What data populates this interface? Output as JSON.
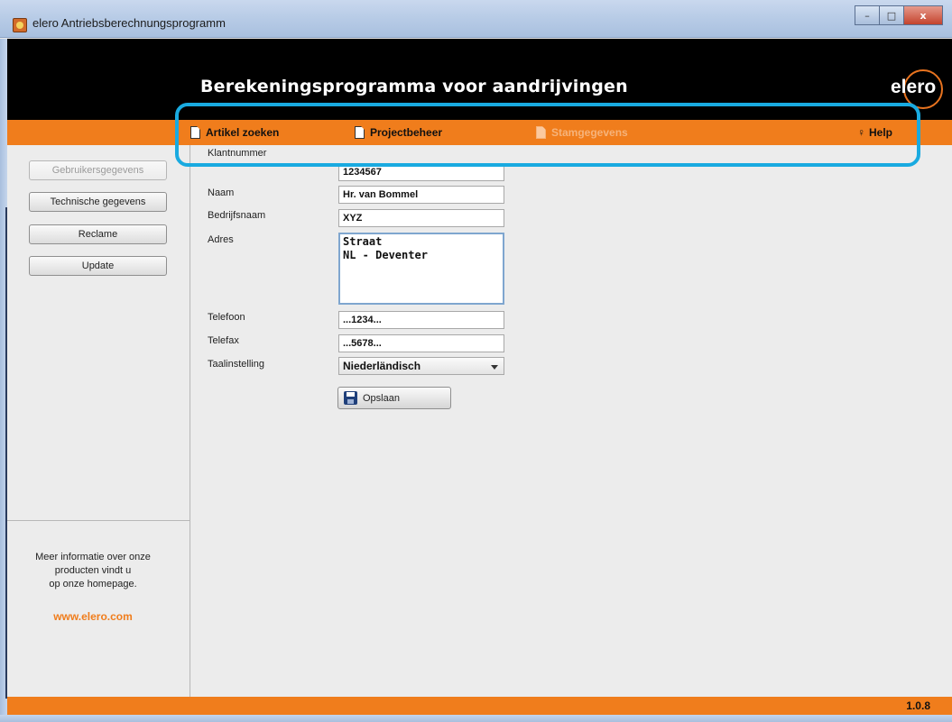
{
  "window": {
    "title": "elero Antriebsberechnungsprogramm",
    "controls": {
      "minimize": "–",
      "maximize": "□",
      "close": "x"
    }
  },
  "header": {
    "title": "Berekeningsprogramma voor aandrijvingen",
    "logo_text": "elero",
    "background_color": "#000000",
    "accent_color": "#f07d1c"
  },
  "nav": {
    "items": [
      {
        "label": "Artikel zoeken",
        "icon": "document-icon",
        "enabled": true
      },
      {
        "label": "Projectbeheer",
        "icon": "document-icon",
        "enabled": true
      },
      {
        "label": "Stamgegevens",
        "icon": "document-icon",
        "enabled": false
      },
      {
        "label": "Help",
        "icon": "help-icon",
        "enabled": true
      }
    ]
  },
  "sidebar": {
    "buttons": [
      {
        "label": "Gebruikersgegevens",
        "enabled": false
      },
      {
        "label": "Technische gegevens",
        "enabled": true
      },
      {
        "label": "Reclame",
        "enabled": true
      },
      {
        "label": "Update",
        "enabled": true
      }
    ],
    "info_text": "Meer informatie over onze producten vindt u op onze homepage.",
    "info_lines": [
      "Meer informatie over onze",
      "producten vindt u",
      "op onze homepage."
    ],
    "link": "www.elero.com"
  },
  "form": {
    "fields": {
      "klantnummer": {
        "label": "Klantnummer",
        "value": "1234567"
      },
      "naam": {
        "label": "Naam",
        "value": "Hr. van Bommel"
      },
      "bedrijfsnaam": {
        "label": "Bedrijfsnaam",
        "value": "XYZ"
      },
      "adres": {
        "label": "Adres",
        "lines": [
          "Straat",
          "NL - Deventer"
        ]
      },
      "telefoon": {
        "label": "Telefoon",
        "value": "...1234..."
      },
      "telefax": {
        "label": "Telefax",
        "value": "...5678..."
      },
      "taalinstelling": {
        "label": "Taalinstelling",
        "value": "Niederländisch"
      }
    },
    "save_label": "Opslaan"
  },
  "status": {
    "version": "1.0.8"
  }
}
